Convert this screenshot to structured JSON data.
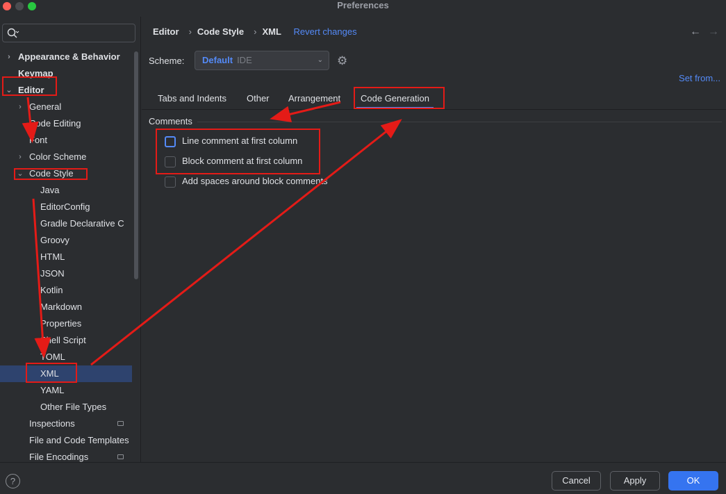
{
  "window": {
    "title": "Preferences"
  },
  "sidebar": {
    "items": [
      {
        "label": "Appearance & Behavior",
        "bold": true,
        "chevron": ">"
      },
      {
        "label": "Keymap",
        "bold": true
      },
      {
        "label": "Editor",
        "bold": true,
        "chevron": "v"
      },
      {
        "label": "General",
        "chevron": ">"
      },
      {
        "label": "Code Editing"
      },
      {
        "label": "Font"
      },
      {
        "label": "Color Scheme",
        "chevron": ">"
      },
      {
        "label": "Code Style",
        "chevron": "v"
      },
      {
        "label": "Java"
      },
      {
        "label": "EditorConfig"
      },
      {
        "label": "Gradle Declarative C"
      },
      {
        "label": "Groovy"
      },
      {
        "label": "HTML"
      },
      {
        "label": "JSON"
      },
      {
        "label": "Kotlin"
      },
      {
        "label": "Markdown"
      },
      {
        "label": "Properties"
      },
      {
        "label": "Shell Script"
      },
      {
        "label": "TOML"
      },
      {
        "label": "XML",
        "selected": true
      },
      {
        "label": "YAML"
      },
      {
        "label": "Other File Types"
      },
      {
        "label": "Inspections"
      },
      {
        "label": "File and Code Templates"
      },
      {
        "label": "File Encodings"
      }
    ]
  },
  "breadcrumb": {
    "items": [
      "Editor",
      "Code Style",
      "XML"
    ],
    "revert": "Revert changes"
  },
  "scheme": {
    "label": "Scheme:",
    "value": "Default",
    "suffix": "IDE",
    "set_from": "Set from..."
  },
  "tabs": [
    "Tabs and Indents",
    "Other",
    "Arrangement",
    "Code Generation"
  ],
  "active_tab": "Code Generation",
  "comments": {
    "title": "Comments",
    "options": [
      {
        "label": "Line comment at first column",
        "checked": false
      },
      {
        "label": "Block comment at first column",
        "checked": false
      },
      {
        "label": "Add spaces around block comments",
        "checked": false
      }
    ]
  },
  "footer": {
    "help": "?",
    "cancel": "Cancel",
    "apply": "Apply",
    "ok": "OK"
  },
  "colors": {
    "accent": "#548af7",
    "annotation": "#e41b17",
    "selection": "#2e436e"
  }
}
